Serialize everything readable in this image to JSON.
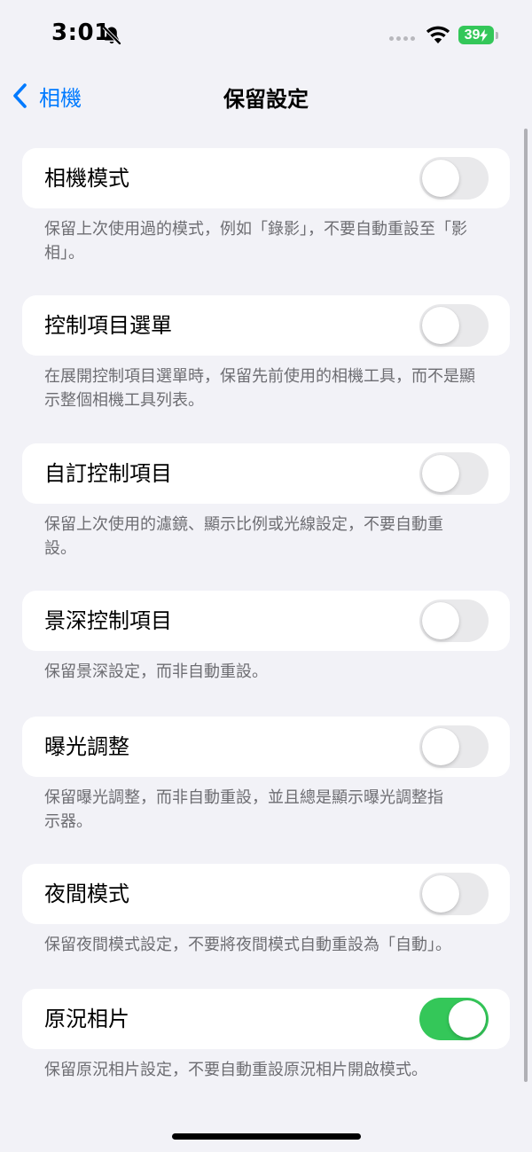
{
  "status_bar": {
    "time": "3:01",
    "battery": "39",
    "icons": [
      "bell-slash-icon",
      "signal-dots-icon",
      "wifi-icon",
      "battery-charging-icon"
    ]
  },
  "nav": {
    "back_label": "相機",
    "title": "保留設定"
  },
  "colors": {
    "accent": "#007aff",
    "toggle_on": "#34c759",
    "toggle_off": "#e9e9eb",
    "background": "#f2f2f7"
  },
  "settings": [
    {
      "label": "相機模式",
      "enabled": false,
      "footer": "保留上次使用過的模式，例如「錄影」，不要自動重設至「影相」。"
    },
    {
      "label": "控制項目選單",
      "enabled": false,
      "footer": "在展開控制項目選單時，保留先前使用的相機工具，而不是顯示整個相機工具列表。"
    },
    {
      "label": "自訂控制項目",
      "enabled": false,
      "footer": "保留上次使用的濾鏡、顯示比例或光線設定，不要自動重設。"
    },
    {
      "label": "景深控制項目",
      "enabled": false,
      "footer": "保留景深設定，而非自動重設。"
    },
    {
      "label": "曝光調整",
      "enabled": false,
      "footer": "保留曝光調整，而非自動重設，並且總是顯示曝光調整指示器。"
    },
    {
      "label": "夜間模式",
      "enabled": false,
      "footer": "保留夜間模式設定，不要將夜間模式自動重設為「自動」。"
    },
    {
      "label": "原況相片",
      "enabled": true,
      "footer": "保留原況相片設定，不要自動重設原況相片開啟模式。"
    }
  ]
}
